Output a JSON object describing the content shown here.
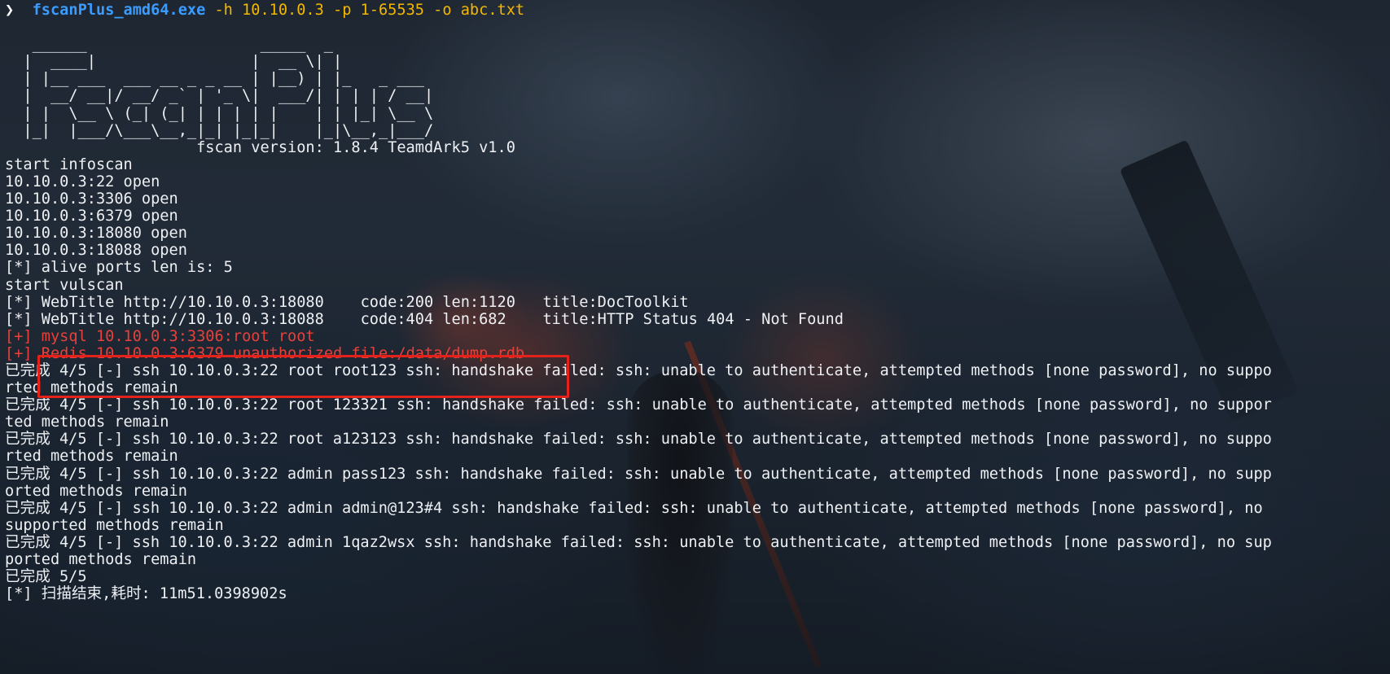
{
  "terminal": {
    "prompt_symbol": "❯",
    "command_exe": "fscanPlus_amd64.exe",
    "command_args": " -h 10.10.0.3 -p 1-65535 -o abc.txt",
    "banner": [
      "   ______                   _____  _",
      "  |  ____|                 |  __ \\| |",
      "  | |__ ___  ___ __ _ _ __ | |__) | |_   _ ___",
      "  |  __/ __|/ __/ _` | '_ \\|  ___/| | | | / __|",
      "  | |  \\__ \\ (_| (_| | | | | |    | | |_| \\__ \\",
      "  |_|  |___/\\___\\__,_|_| |_|_|    |_|\\__,_|___/"
    ],
    "version_line": "                     fscan version: 1.8.4 TeamdArk5 v1.0",
    "lines_before": [
      "start infoscan",
      "10.10.0.3:22 open",
      "10.10.0.3:3306 open",
      "10.10.0.3:6379 open",
      "10.10.0.3:18080 open",
      "10.10.0.3:18088 open",
      "[*] alive ports len is: 5",
      "start vulscan",
      "[*] WebTitle http://10.10.0.3:18080    code:200 len:1120   title:DocToolkit",
      "[*] WebTitle http://10.10.0.3:18088    code:404 len:682    title:HTTP Status 404 - Not Found"
    ],
    "vuln_lines": [
      {
        "tag": "[+]",
        "text": " mysql 10.10.0.3:3306:root root"
      },
      {
        "tag": "[+]",
        "text": " Redis 10.10.0.3:6379 unauthorized file:/data/dump.rdb"
      }
    ],
    "lines_after": [
      "已完成 4/5 [-] ssh 10.10.0.3:22 root root123 ssh: handshake failed: ssh: unable to authenticate, attempted methods [none password], no suppo",
      "rted methods remain",
      "已完成 4/5 [-] ssh 10.10.0.3:22 root 123321 ssh: handshake failed: ssh: unable to authenticate, attempted methods [none password], no suppor",
      "ted methods remain",
      "已完成 4/5 [-] ssh 10.10.0.3:22 root a123123 ssh: handshake failed: ssh: unable to authenticate, attempted methods [none password], no suppo",
      "rted methods remain",
      "已完成 4/5 [-] ssh 10.10.0.3:22 admin pass123 ssh: handshake failed: ssh: unable to authenticate, attempted methods [none password], no supp",
      "orted methods remain",
      "已完成 4/5 [-] ssh 10.10.0.3:22 admin admin@123#4 ssh: handshake failed: ssh: unable to authenticate, attempted methods [none password], no",
      "supported methods remain",
      "已完成 4/5 [-] ssh 10.10.0.3:22 admin 1qaz2wsx ssh: handshake failed: ssh: unable to authenticate, attempted methods [none password], no sup",
      "ported methods remain",
      "已完成 5/5",
      "[*] 扫描结束,耗时: 11m51.0398902s"
    ]
  },
  "colors": {
    "prompt": "#ffffff",
    "exe": "#3b9cff",
    "args": "#f5b800",
    "vuln": "#e6413b",
    "highlight_box": "#e3231b",
    "text": "#eef0f3"
  }
}
